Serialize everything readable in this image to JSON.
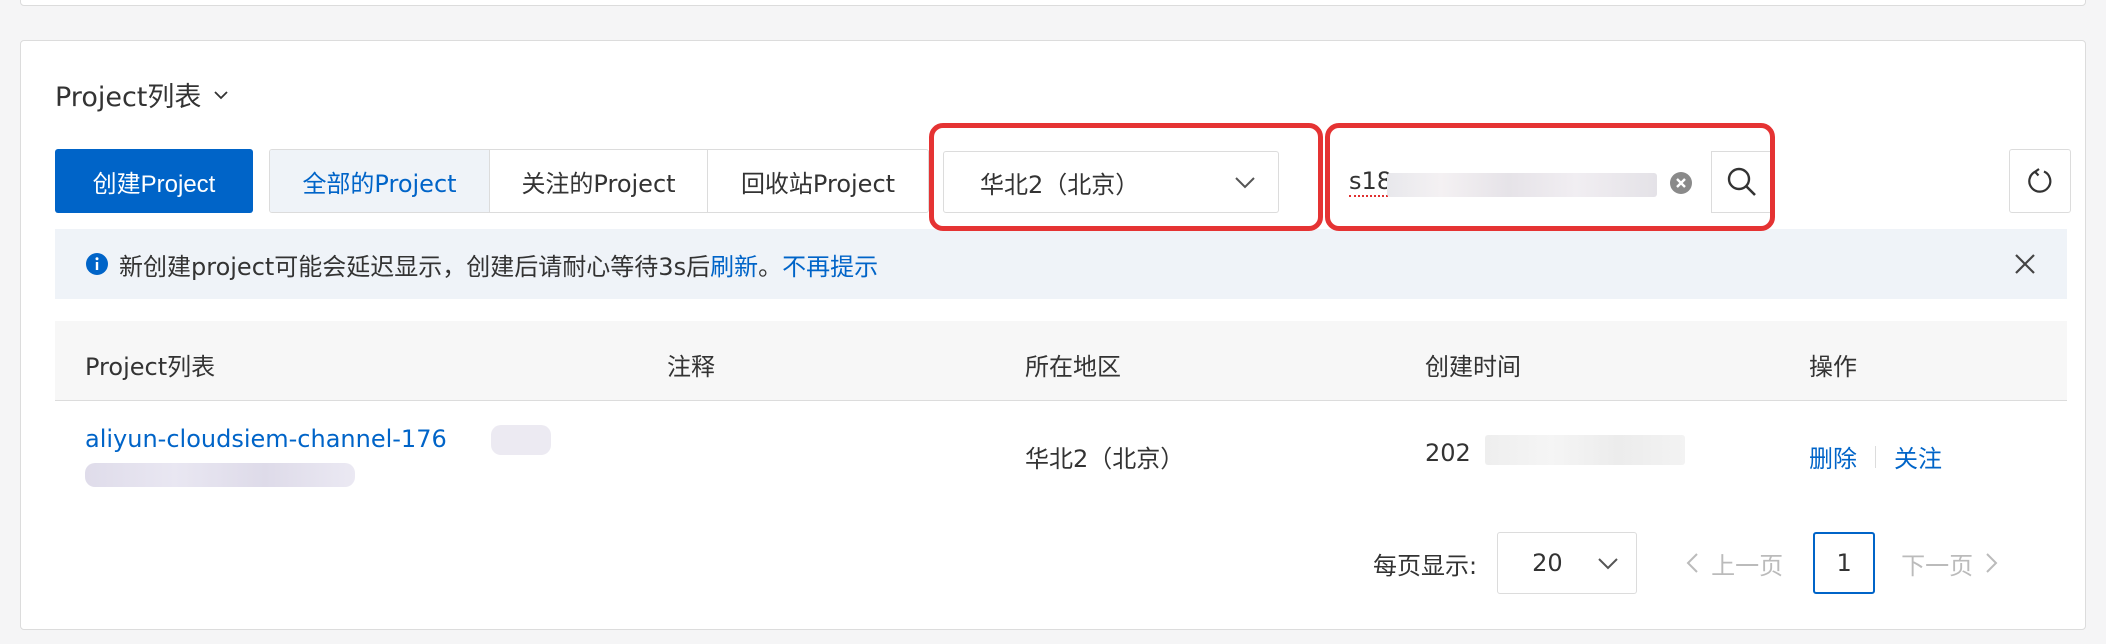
{
  "card": {
    "title": "Project列表"
  },
  "toolbar": {
    "create_label": "创建Project",
    "tabs": [
      {
        "label": "全部的Project",
        "active": true
      },
      {
        "label": "关注的Project",
        "active": false
      },
      {
        "label": "回收站Project",
        "active": false
      }
    ],
    "region_value": "华北2（北京）",
    "search_value": "s18"
  },
  "notice": {
    "text": "新创建project可能会延迟显示，创建后请耐心等待3s后 ",
    "refresh_link": "刷新",
    "period": "。",
    "dismiss_link": "不再提示"
  },
  "table": {
    "headers": [
      "Project列表",
      "注释",
      "所在地区",
      "创建时间",
      "操作"
    ],
    "rows": [
      {
        "name": "aliyun-cloudsiem-channel-176",
        "comment": "",
        "region": "华北2（北京）",
        "created": "202",
        "action_delete": "删除",
        "action_follow": "关注"
      }
    ]
  },
  "pagination": {
    "per_page_label": "每页显示:",
    "per_page_value": "20",
    "prev_label": "上一页",
    "current_page": "1",
    "next_label": "下一页"
  },
  "colors": {
    "primary": "#0064c8",
    "highlight": "#e53333",
    "notice_bg": "#eff3f8"
  }
}
